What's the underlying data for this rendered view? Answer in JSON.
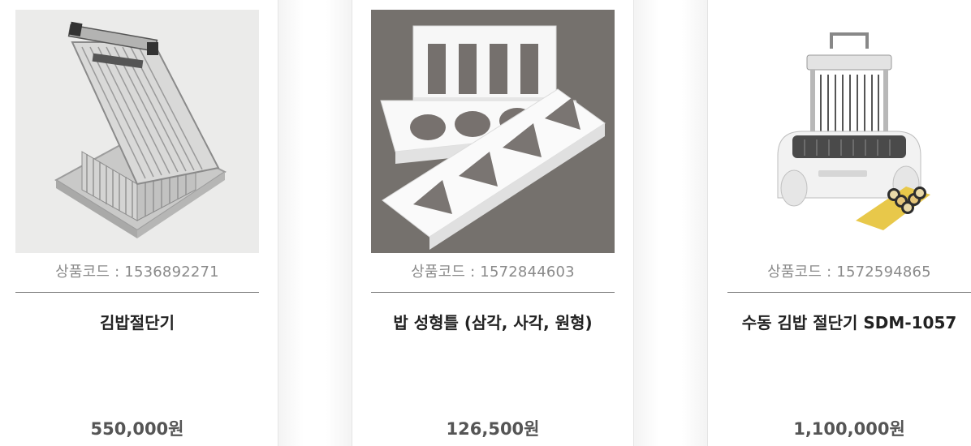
{
  "products": [
    {
      "code_label": "상품코드 : 1536892271",
      "name": "김밥절단기",
      "price": "550,000원",
      "image": "kimbap-cutter-lever-photo"
    },
    {
      "code_label": "상품코드 : 1572844603",
      "name": "밥 성형틀 (삼각, 사각, 원형)",
      "price": "126,500원",
      "image": "rice-mold-white-photo"
    },
    {
      "code_label": "상품코드 : 1572594865",
      "name": "수동 김밥 절단기 SDM-1057",
      "price": "1,100,000원",
      "image": "manual-kimbap-cutter-photo"
    }
  ],
  "colors": {
    "code_text": "#8a8a8a",
    "name_text": "#222222",
    "price_text": "#555555",
    "divider": "#777777"
  }
}
